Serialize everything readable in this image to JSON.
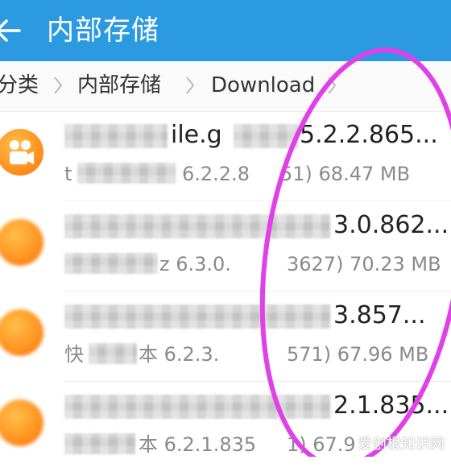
{
  "appbar": {
    "title": "内部存储"
  },
  "breadcrumb": {
    "items": [
      "分类",
      "内部存储",
      "Download"
    ]
  },
  "files": [
    {
      "title": "ile.g",
      "title_end": "5.2.2.865...",
      "sub_start": "t",
      "sub": "6.2.2.8",
      "sub_end": "51) 68.47 MB"
    },
    {
      "title": "",
      "title_end": "3.0.862...",
      "sub_start": "",
      "sub": "z 6.3.0.",
      "sub_end": "3627) 70.23 MB"
    },
    {
      "title": "",
      "title_end": "3.857...",
      "sub_start": "快",
      "sub": "本 6.2.3.",
      "sub_end": "571) 67.96 MB"
    },
    {
      "title": "",
      "title_end": "2.1.835...",
      "sub_start": "",
      "sub": "本 6.2.1.835",
      "sub_end": "1) 67.9"
    }
  ],
  "watermark": "爱创根知识网",
  "colors": {
    "appbar": "#2b9ae0",
    "annotation": "#e040e8",
    "icon": "#ff8a1a"
  }
}
